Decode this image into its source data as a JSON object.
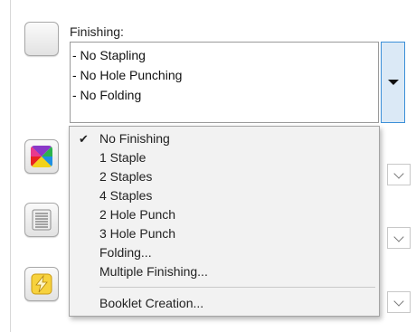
{
  "finishing": {
    "label": "Finishing:",
    "summary": [
      "- No Stapling",
      "- No Hole Punching",
      "- No Folding"
    ]
  },
  "menu": {
    "items": [
      {
        "label": "No Finishing",
        "checked": true
      },
      {
        "label": "1 Staple"
      },
      {
        "label": "2 Staples"
      },
      {
        "label": "4 Staples"
      },
      {
        "label": "2 Hole Punch"
      },
      {
        "label": "3 Hole Punch"
      },
      {
        "label": "Folding..."
      },
      {
        "label": "Multiple Finishing..."
      }
    ],
    "footer_item": "Booklet Creation...",
    "check_glyph": "✔"
  },
  "icons": {
    "finishing": "blank-square-icon",
    "color": "color-palette-icon",
    "document": "lined-page-icon",
    "power": "lightning-icon"
  },
  "colors": {
    "dropdown_highlight": "#3b8fd8",
    "menu_background": "#f2f2f2"
  }
}
